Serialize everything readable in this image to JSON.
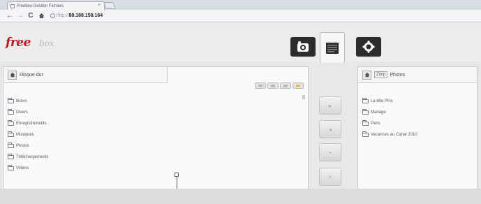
{
  "browser": {
    "tab_title": "Freebox Gestion Fichiers",
    "tab_close": "×",
    "url_protocol": "http://",
    "url_host": "88.188.158.164"
  },
  "app": {
    "logo_text": "free",
    "logo_sub": "box",
    "nav_buttons": [
      "downloads-icon",
      "files-icon",
      "settings-icon"
    ],
    "active_button": "files-icon",
    "accent_color": "#c4161c"
  },
  "left_panel": {
    "title": "Disque dur",
    "folders": [
      "Bravo",
      "Divers",
      "Enregistrements",
      "Musiques",
      "Photos",
      "Téléchargements",
      "Vidéos"
    ]
  },
  "right_panel": {
    "crumb": "Zimp",
    "title": "Photos",
    "folders": [
      "La tête Pins",
      "Mariage",
      "Paris",
      "Vacances au Canal 2010"
    ]
  },
  "transfer_buttons": [
    "copy-right-button",
    "copy-left-button",
    "move-button",
    "delete-button"
  ]
}
